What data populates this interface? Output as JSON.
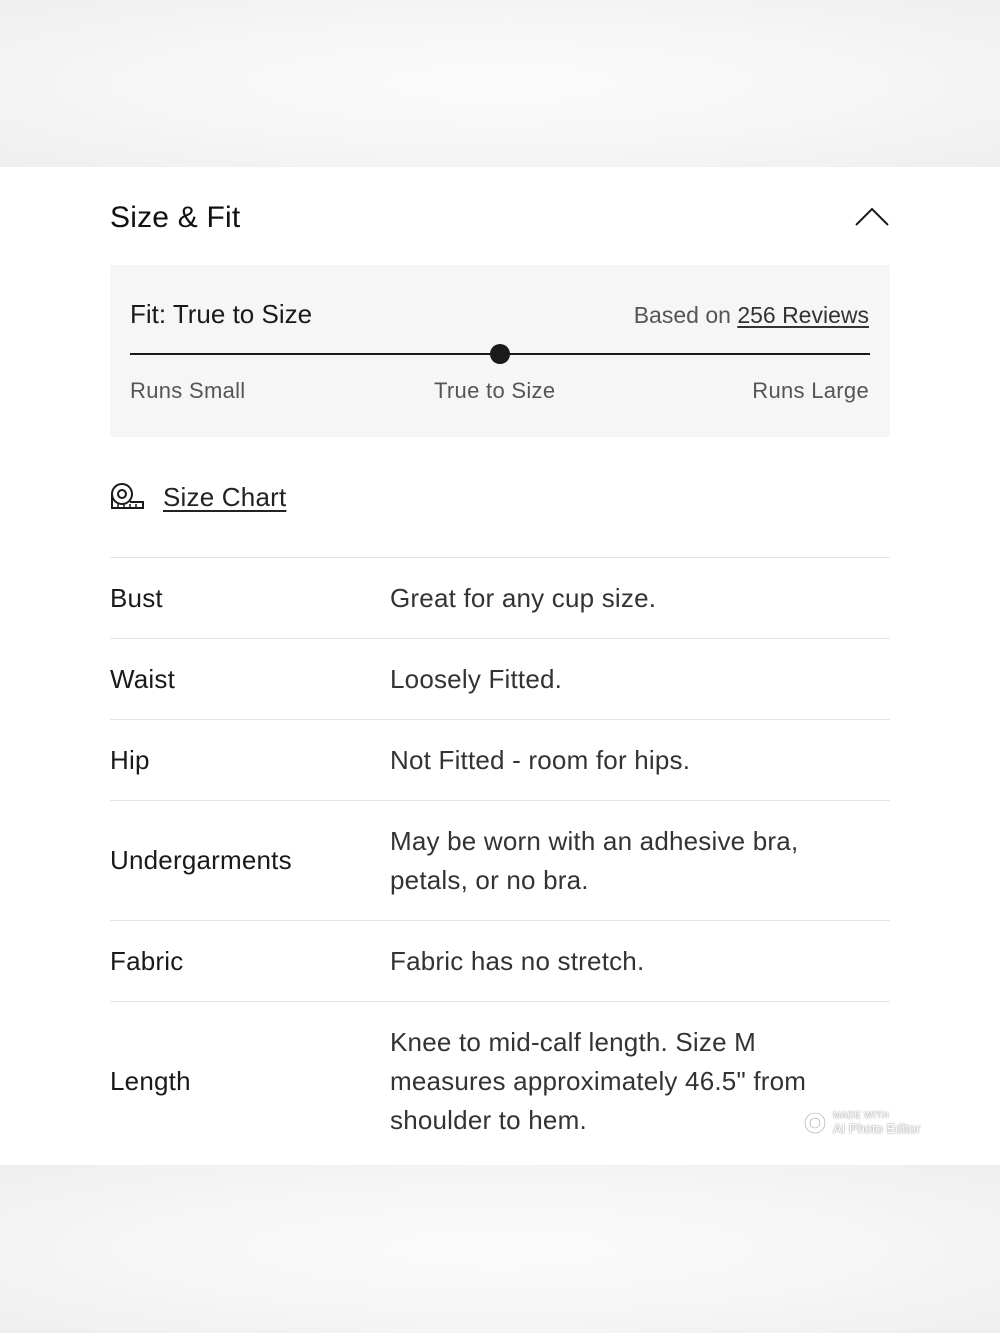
{
  "section": {
    "title": "Size & Fit",
    "toggle_icon": "chevron-up-icon"
  },
  "fit": {
    "label": "Fit: True to Size",
    "based_on_prefix": "Based on",
    "reviews_link": "256 Reviews",
    "position_fraction": 0.5,
    "scale": {
      "left": "Runs Small",
      "middle": "True to Size",
      "right": "Runs Large"
    }
  },
  "size_chart": {
    "icon": "measuring-tape-icon",
    "label": "Size Chart"
  },
  "attributes": [
    {
      "name": "Bust",
      "value": "Great for any cup size."
    },
    {
      "name": "Waist",
      "value": "Loosely Fitted."
    },
    {
      "name": "Hip",
      "value": "Not Fitted - room for hips."
    },
    {
      "name": "Undergarments",
      "value": "May be worn with an adhesive bra, petals, or no bra."
    },
    {
      "name": "Fabric",
      "value": "Fabric has no stretch."
    },
    {
      "name": "Length",
      "value": "Knee to mid-calf length. Size M measures approximately 46.5\" from shoulder to hem."
    }
  ],
  "watermark": {
    "top": "MADE WITH",
    "bottom": "AI Photo Editor"
  },
  "colors": {
    "panel_background": "#f6f6f6",
    "text_primary": "#1a1a1a",
    "text_secondary": "#555555",
    "divider": "#e4e4e4"
  }
}
